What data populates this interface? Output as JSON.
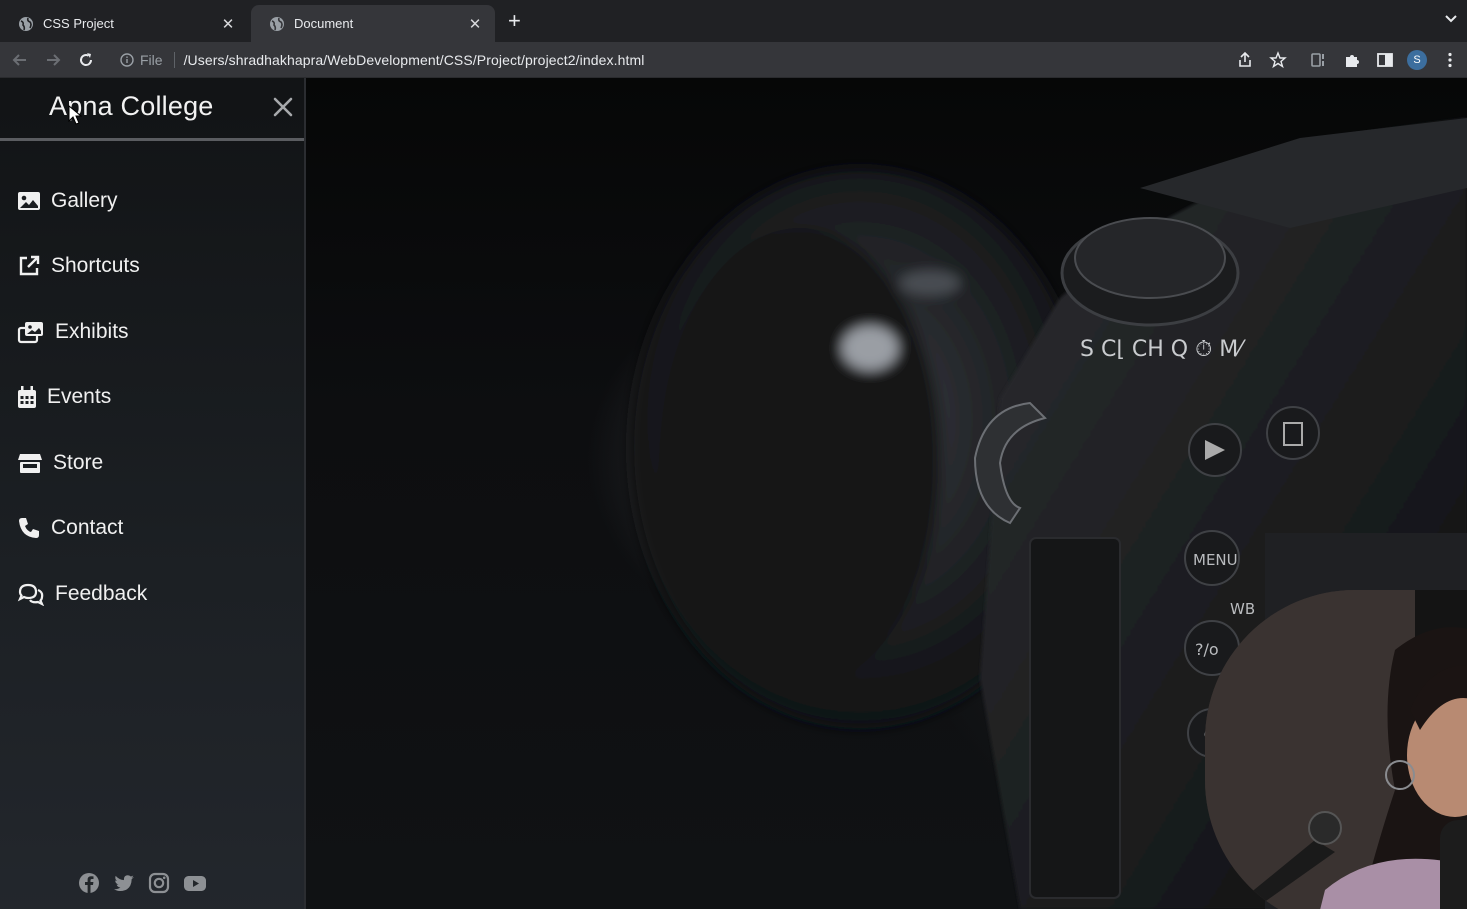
{
  "browser": {
    "tabs": [
      {
        "label": "CSS Project",
        "active": false
      },
      {
        "label": "Document",
        "active": true
      }
    ],
    "new_tab_label": "+",
    "address": {
      "scheme": "File",
      "url": "/Users/shradhakhapra/WebDevelopment/CSS/Project/project2/index.html"
    },
    "profile_initial": "S",
    "icons": [
      "back-icon",
      "forward-icon",
      "reload-icon",
      "info-icon",
      "share-icon",
      "star-icon",
      "extension-icon",
      "puzzle-icon",
      "sidepanel-icon",
      "more-icon"
    ]
  },
  "sidebar": {
    "brand": "Apna College",
    "close_icon": "close-icon",
    "items": [
      {
        "label": "Gallery",
        "icon": "image-icon"
      },
      {
        "label": "Shortcuts",
        "icon": "external-link-icon"
      },
      {
        "label": "Exhibits",
        "icon": "photo-stack-icon"
      },
      {
        "label": "Events",
        "icon": "calendar-icon"
      },
      {
        "label": "Store",
        "icon": "store-icon"
      },
      {
        "label": "Contact",
        "icon": "phone-icon"
      },
      {
        "label": "Feedback",
        "icon": "comments-icon"
      }
    ],
    "social": [
      "facebook-icon",
      "twitter-icon",
      "instagram-icon",
      "youtube-icon"
    ]
  },
  "colors": {
    "chrome_bg": "#202124",
    "toolbar_bg": "#35363a",
    "sidebar_text": "#f0f0f0",
    "page_bg": "#0a0b0c"
  }
}
